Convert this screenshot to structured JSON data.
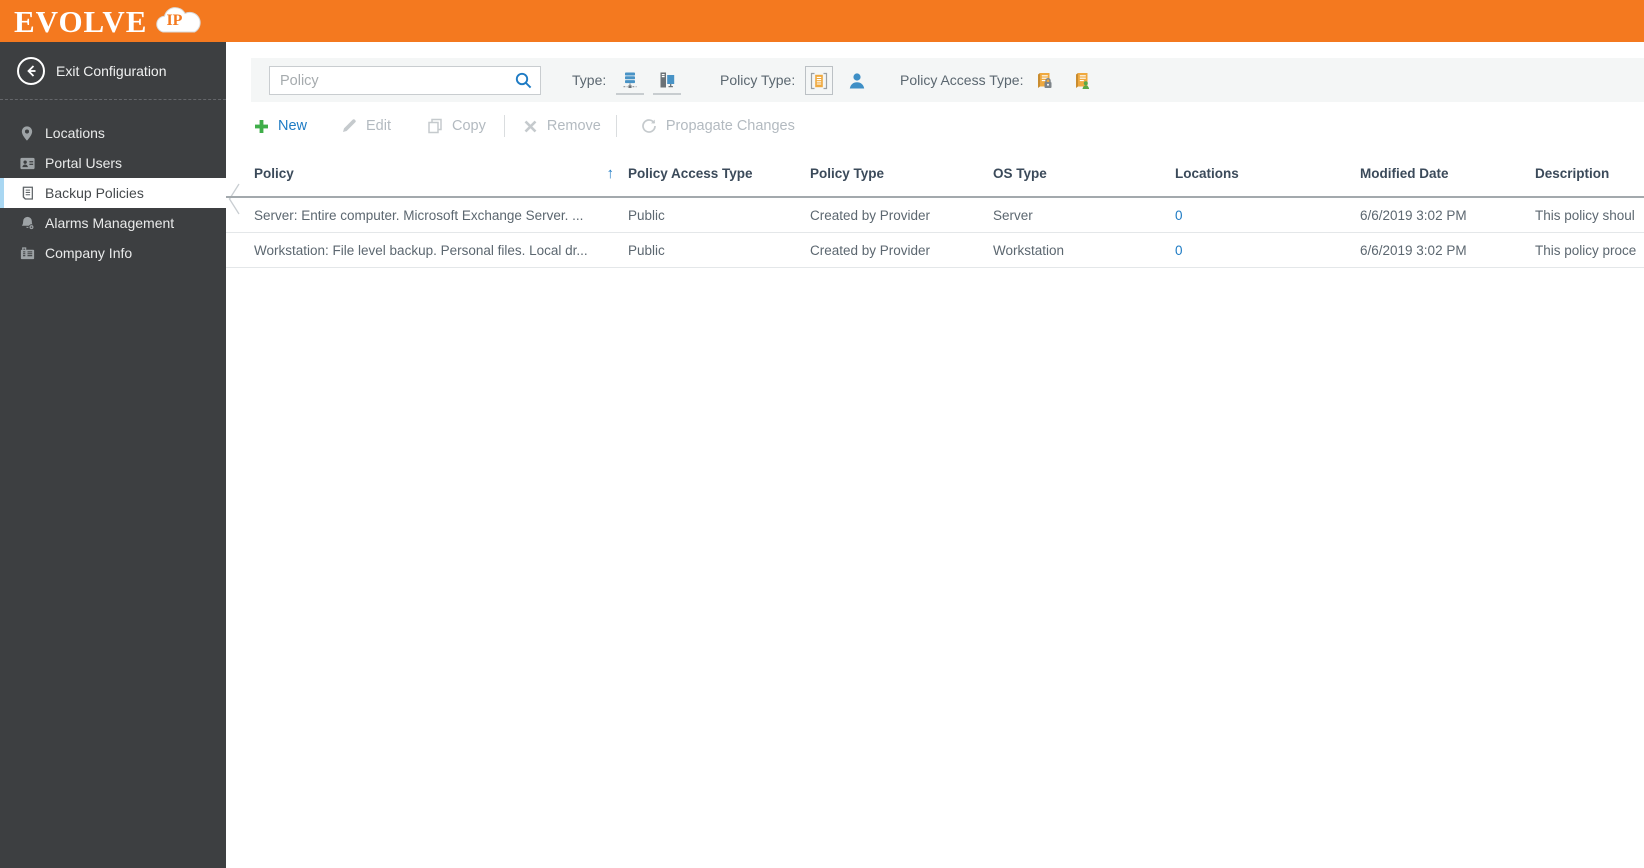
{
  "header": {
    "logo_text": "EVOLVE",
    "logo_badge": "IP"
  },
  "sidebar": {
    "exit_label": "Exit Configuration",
    "items": [
      {
        "label": "Locations",
        "icon": "location-pin-icon",
        "selected": false
      },
      {
        "label": "Portal Users",
        "icon": "portal-users-icon",
        "selected": false
      },
      {
        "label": "Backup Policies",
        "icon": "backup-policies-icon",
        "selected": true
      },
      {
        "label": "Alarms Management",
        "icon": "alarms-icon",
        "selected": false
      },
      {
        "label": "Company Info",
        "icon": "company-info-icon",
        "selected": false
      }
    ]
  },
  "filters": {
    "search": {
      "placeholder": "Policy"
    },
    "type_label": "Type:",
    "type_options": [
      "server-filter-icon",
      "workstation-filter-icon"
    ],
    "policy_type_label": "Policy Type:",
    "policy_type_options": [
      "provider-policy-icon",
      "user-policy-icon"
    ],
    "policy_access_type_label": "Policy Access Type:",
    "policy_access_type_options": [
      "private-policy-icon",
      "public-policy-icon"
    ]
  },
  "toolbar": {
    "new_label": "New",
    "edit_label": "Edit",
    "copy_label": "Copy",
    "remove_label": "Remove",
    "propagate_label": "Propagate Changes"
  },
  "table": {
    "columns": [
      "Policy",
      "Policy Access Type",
      "Policy Type",
      "OS Type",
      "Locations",
      "Modified Date",
      "Description"
    ],
    "sort": {
      "column": "Policy",
      "direction": "asc",
      "glyph": "↑"
    },
    "rows": [
      {
        "policy": "Server: Entire computer. Microsoft Exchange Server. ...",
        "access": "Public",
        "type": "Created by Provider",
        "os": "Server",
        "locations": "0",
        "modified": "6/6/2019 3:02 PM",
        "description": "This policy shoul"
      },
      {
        "policy": "Workstation: File level backup. Personal files. Local dr...",
        "access": "Public",
        "type": "Created by Provider",
        "os": "Workstation",
        "locations": "0",
        "modified": "6/6/2019 3:02 PM",
        "description": "This policy proce"
      }
    ]
  },
  "colors": {
    "brand_orange": "#F4791F",
    "sidebar_bg": "#3D3F41",
    "selected_accent": "#A9D7F2",
    "link_blue": "#1E7BC4",
    "new_plus_green": "#3FAE49",
    "filter_strip_bg": "#F4F6F6"
  }
}
